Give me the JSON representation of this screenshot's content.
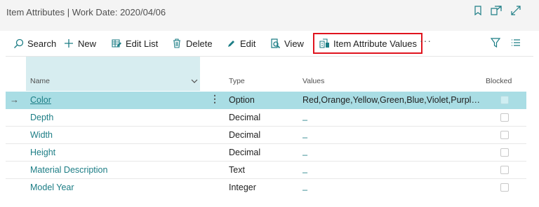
{
  "header": {
    "title": "Item Attributes | Work Date: 2020/04/06"
  },
  "actions": {
    "search": "Search",
    "new": "New",
    "edit_list": "Edit List",
    "delete": "Delete",
    "edit": "Edit",
    "view": "View",
    "item_attribute_values": "Item Attribute Values",
    "more": "···"
  },
  "columns": {
    "name": "Name",
    "type": "Type",
    "values": "Values",
    "blocked": "Blocked"
  },
  "rows": [
    {
      "name": "Color",
      "type": "Option",
      "values": "Red,Orange,Yellow,Green,Blue,Violet,Purple,...",
      "blocked": false,
      "selected": true
    },
    {
      "name": "Depth",
      "type": "Decimal",
      "values": "_",
      "blocked": false
    },
    {
      "name": "Width",
      "type": "Decimal",
      "values": "_",
      "blocked": false
    },
    {
      "name": "Height",
      "type": "Decimal",
      "values": "_",
      "blocked": false
    },
    {
      "name": "Material Description",
      "type": "Text",
      "values": "_",
      "blocked": false
    },
    {
      "name": "Model Year",
      "type": "Integer",
      "values": "_",
      "blocked": false
    }
  ],
  "colors": {
    "accent": "#1c7d85",
    "selected_row": "#a9dde4",
    "highlight_border": "#e0141e"
  }
}
